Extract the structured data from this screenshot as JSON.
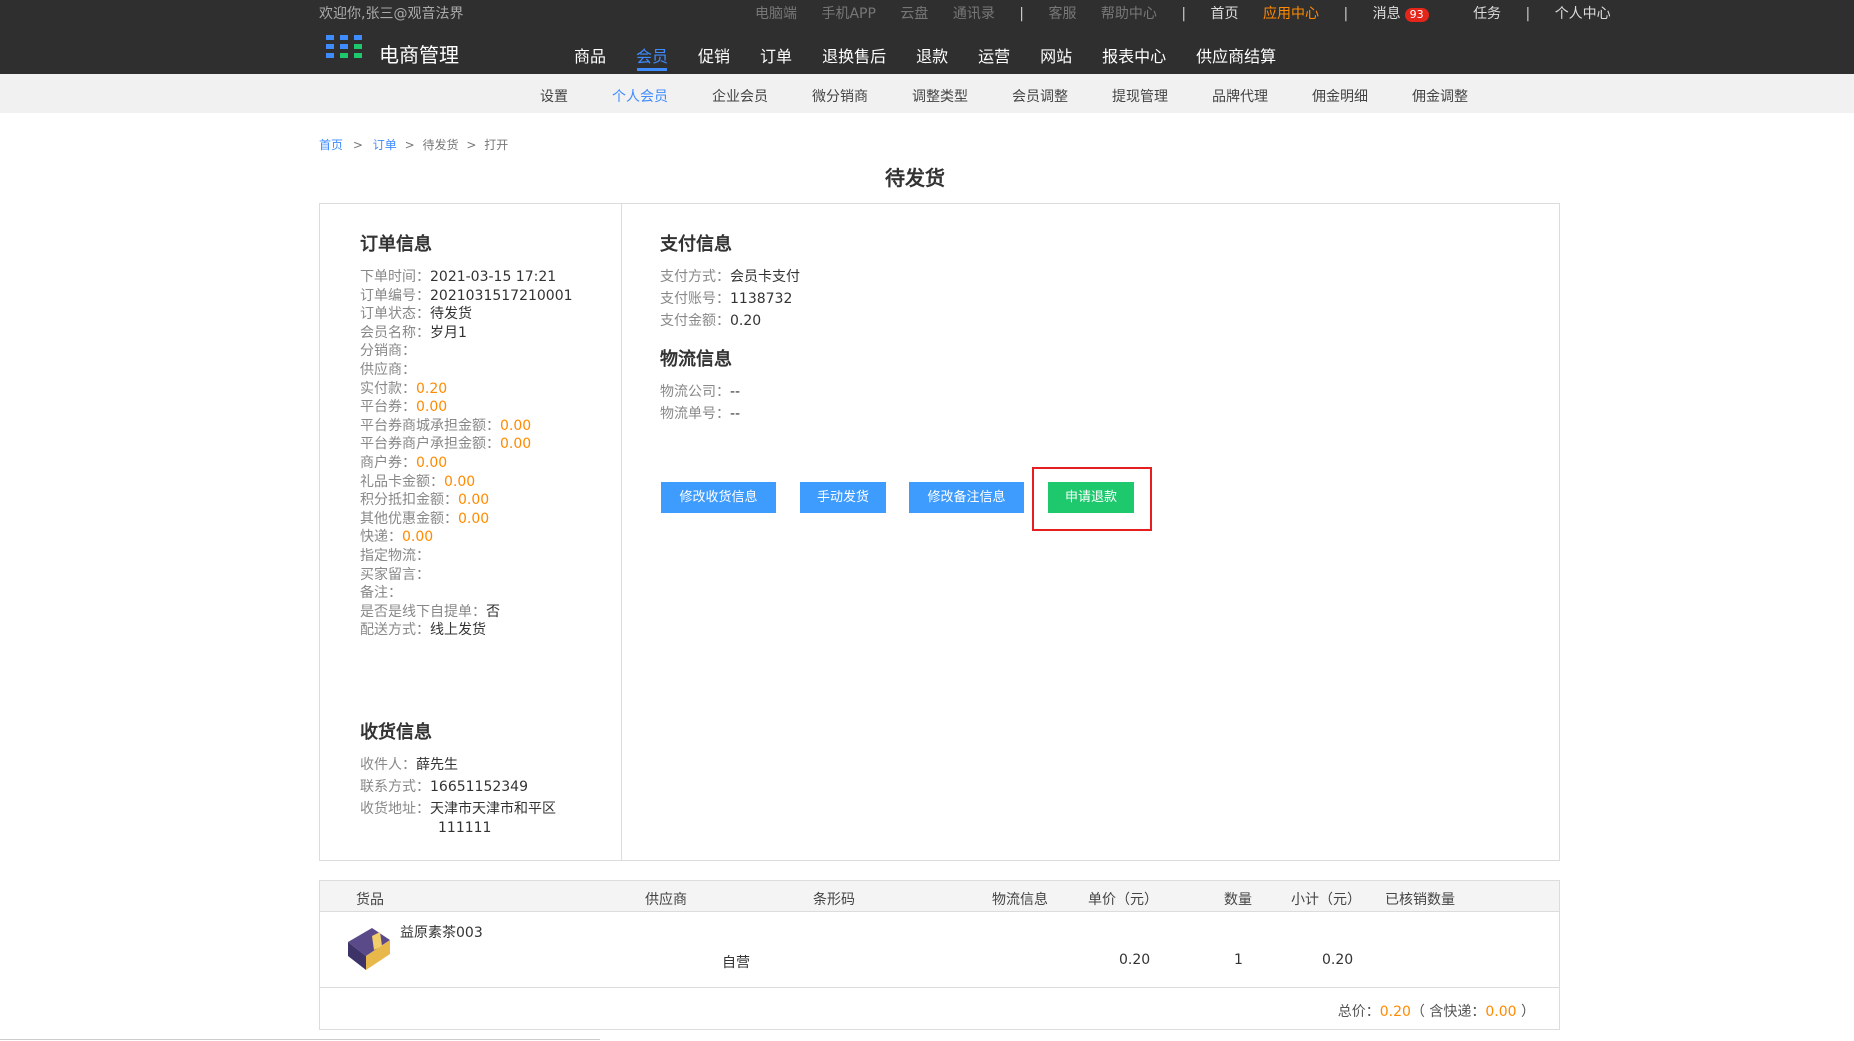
{
  "topbar": {
    "welcome": "欢迎你,张三@观音法界",
    "links_dim": [
      "电脑端",
      "手机APP",
      "云盘",
      "通讯录"
    ],
    "links_mid": [
      "客服",
      "帮助中心"
    ],
    "home": "首页",
    "app_center": "应用中心",
    "messages": "消息",
    "message_count": "93",
    "tasks": "任务",
    "personal": "个人中心"
  },
  "brand": "电商管理",
  "main_nav": [
    "商品",
    "会员",
    "促销",
    "订单",
    "退换售后",
    "退款",
    "运营",
    "网站",
    "报表中心",
    "供应商结算"
  ],
  "sub_nav": [
    "设置",
    "个人会员",
    "企业会员",
    "微分销商",
    "调整类型",
    "会员调整",
    "提现管理",
    "品牌代理",
    "佣金明细",
    "佣金调整"
  ],
  "breadcrumb": {
    "home": "首页",
    "orders": "订单",
    "pending": "待发货",
    "current": "打开",
    "sep": ">"
  },
  "page_title": "待发货",
  "order_info": {
    "title": "订单信息",
    "rows": [
      {
        "k": "下单时间：",
        "v": "2021-03-15 17:21"
      },
      {
        "k": "订单编号：",
        "v": "2021031517210001"
      },
      {
        "k": "订单状态：",
        "v": "待发货"
      },
      {
        "k": "会员名称：",
        "v": "岁月1"
      },
      {
        "k": "分销商：",
        "v": ""
      },
      {
        "k": "供应商：",
        "v": ""
      },
      {
        "k": "实付款：",
        "v": "0.20"
      },
      {
        "k": "平台券：",
        "v": "0.00"
      },
      {
        "k": "平台券商城承担金额：",
        "v": "0.00"
      },
      {
        "k": "平台券商户承担金额：",
        "v": "0.00"
      },
      {
        "k": "商户券：",
        "v": "0.00"
      },
      {
        "k": "礼品卡金额：",
        "v": "0.00"
      },
      {
        "k": "积分抵扣金额：",
        "v": "0.00"
      },
      {
        "k": "其他优惠金额：",
        "v": "0.00"
      },
      {
        "k": "快递：",
        "v": "0.00"
      },
      {
        "k": "指定物流：",
        "v": ""
      },
      {
        "k": "买家留言：",
        "v": ""
      },
      {
        "k": "备注：",
        "v": ""
      },
      {
        "k": "是否是线下自提单：",
        "v": "否"
      },
      {
        "k": "配送方式：",
        "v": "线上发货"
      }
    ]
  },
  "receiver_info": {
    "title": "收货信息",
    "name_k": "收件人：",
    "name_v": "薛先生",
    "phone_k": "联系方式：",
    "phone_v": "16651152349",
    "addr_k": "收货地址：",
    "addr_v1": "天津市天津市和平区",
    "addr_v2": "111111"
  },
  "payment_info": {
    "title": "支付信息",
    "method_k": "支付方式：",
    "method_v": "会员卡支付",
    "account_k": "支付账号：",
    "account_v": "1138732",
    "amount_k": "支付金额：",
    "amount_v": "0.20"
  },
  "logistics_info": {
    "title": "物流信息",
    "company_k": "物流公司：",
    "company_v": "--",
    "number_k": "物流单号：",
    "number_v": "--"
  },
  "buttons": {
    "edit_shipping": "修改收货信息",
    "manual_ship": "手动发货",
    "edit_remark": "修改备注信息",
    "apply_refund": "申请退款"
  },
  "goods_table": {
    "headers": [
      "货品",
      "供应商",
      "条形码",
      "物流信息",
      "单价（元）",
      "数量",
      "小计（元）",
      "已核销数量"
    ],
    "row": {
      "name": "益原素茶003",
      "supplier": "自营",
      "price": "0.20",
      "qty": "1",
      "subtotal": "0.20"
    },
    "total_label": "总价：",
    "total": "0.20",
    "shipping_label": "（ 含快递：",
    "shipping": "0.00",
    "close": " ）"
  },
  "colors": {
    "accent": "#3f8cff",
    "orange": "#ff8a00",
    "green": "#1ec86d",
    "topbar": "#2f2f2f"
  }
}
